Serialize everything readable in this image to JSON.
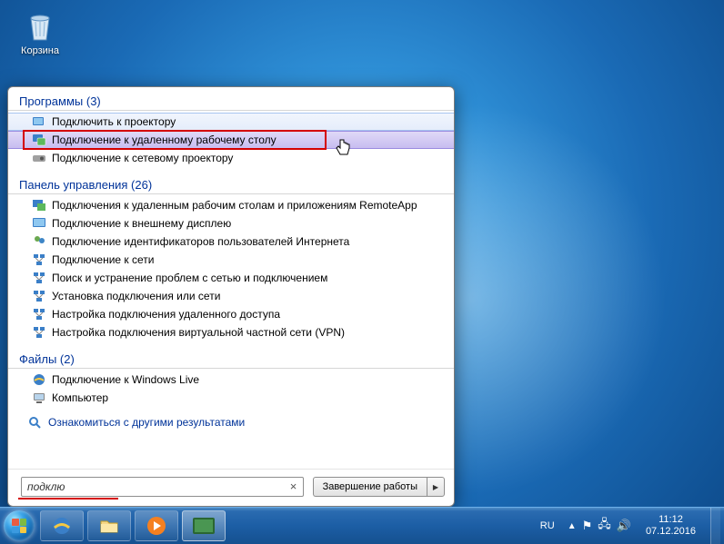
{
  "desktop": {
    "recycle_bin": "Корзина"
  },
  "start_menu": {
    "sections": {
      "programs": {
        "title": "Программы",
        "count": 3
      },
      "control_panel": {
        "title": "Панель управления",
        "count": 26
      },
      "files": {
        "title": "Файлы",
        "count": 2
      }
    },
    "programs_items": [
      {
        "label": "Подключить к проектору",
        "icon": "projector-icon"
      },
      {
        "label": "Подключение к удаленному рабочему столу",
        "icon": "rdp-icon",
        "selected": true,
        "highlighted_red": true
      },
      {
        "label": "Подключение к сетевому проектору",
        "icon": "network-projector-icon"
      }
    ],
    "control_panel_items": [
      {
        "label": "Подключения к удаленным рабочим столам и приложениям RemoteApp",
        "icon": "remoteapp-icon"
      },
      {
        "label": "Подключение к внешнему дисплею",
        "icon": "display-icon"
      },
      {
        "label": "Подключение идентификаторов пользователей Интернета",
        "icon": "users-icon"
      },
      {
        "label": "Подключение к сети",
        "icon": "network-icon"
      },
      {
        "label": "Поиск и устранение проблем с сетью и подключением",
        "icon": "network-icon"
      },
      {
        "label": "Установка подключения или сети",
        "icon": "network-icon"
      },
      {
        "label": "Настройка подключения удаленного доступа",
        "icon": "network-icon"
      },
      {
        "label": "Настройка подключения виртуальной частной сети (VPN)",
        "icon": "network-icon"
      }
    ],
    "files_items": [
      {
        "label": "Подключение к Windows Live",
        "icon": "ie-icon"
      },
      {
        "label": "Компьютер",
        "icon": "computer-icon"
      }
    ],
    "see_more": "Ознакомиться с другими результатами",
    "search_value": "подклю",
    "shutdown_label": "Завершение работы"
  },
  "taskbar": {
    "language": "RU",
    "time": "11:12",
    "date": "07.12.2016"
  }
}
